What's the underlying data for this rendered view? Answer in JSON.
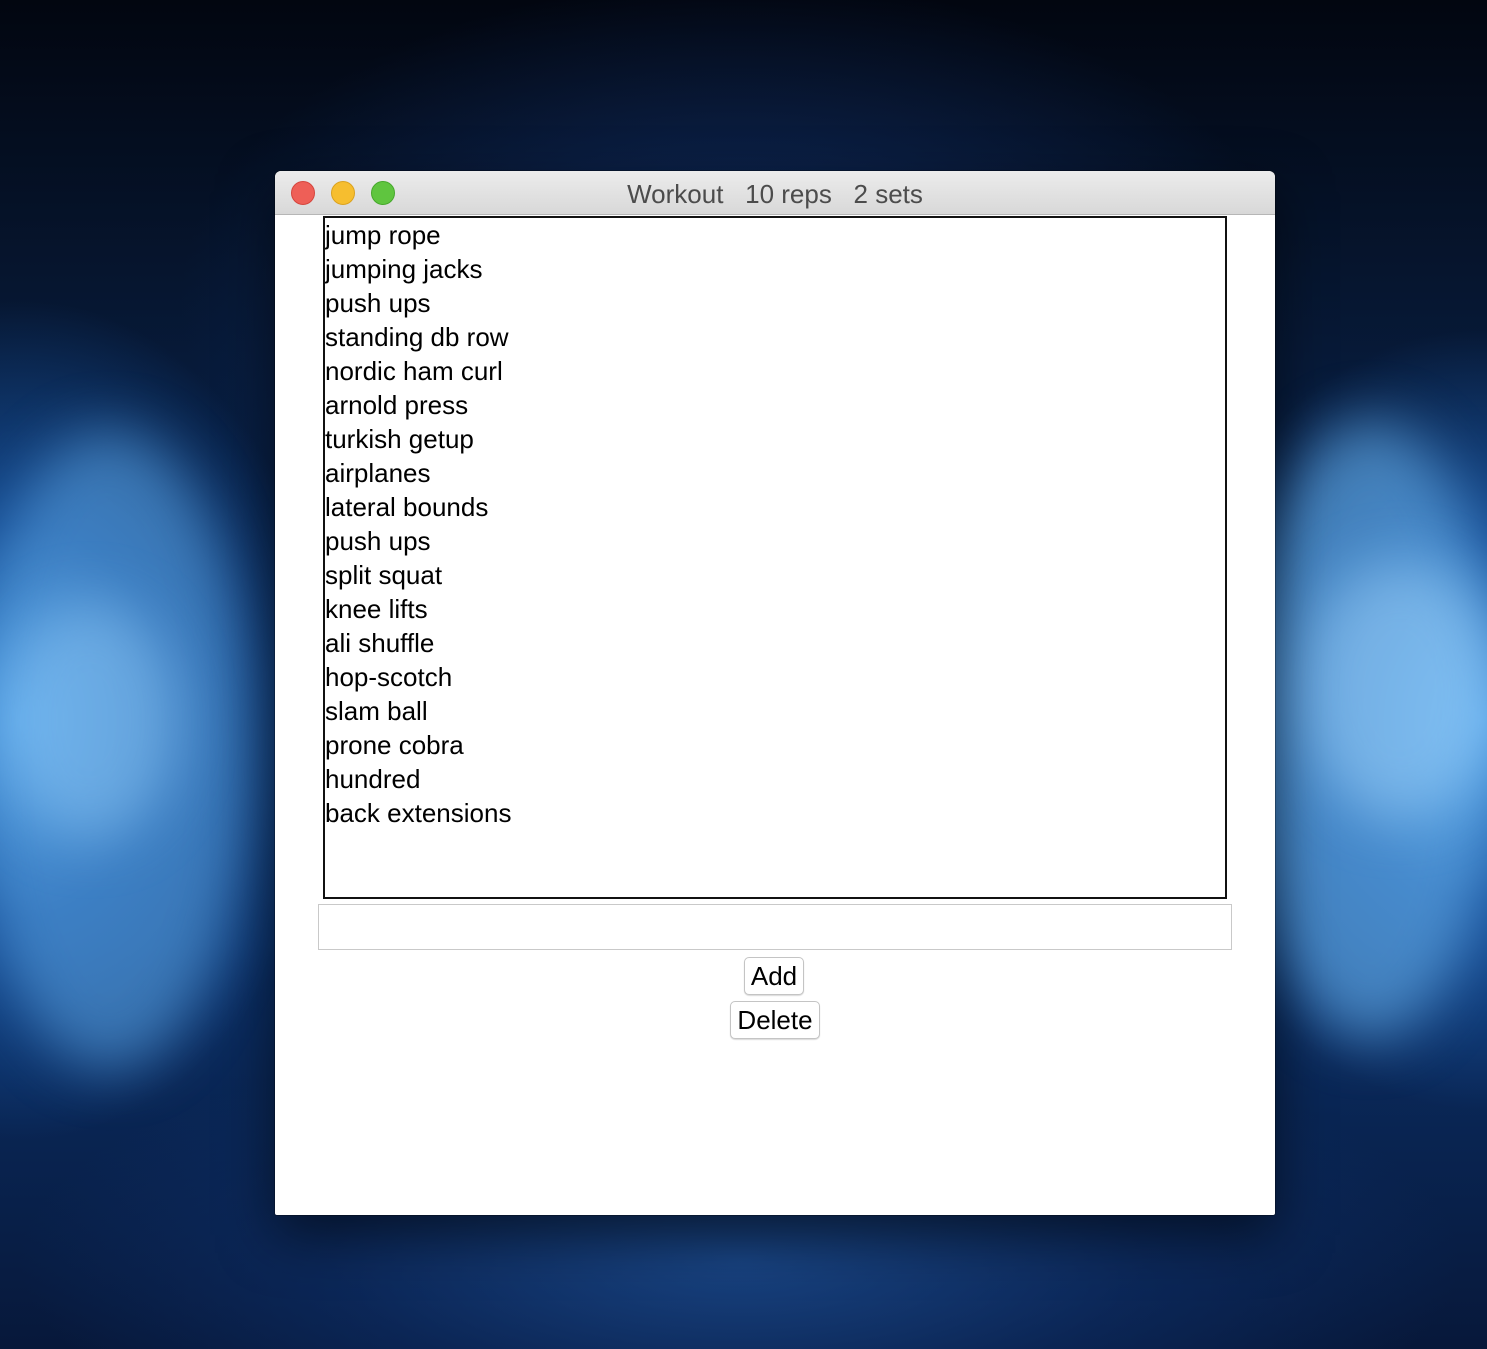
{
  "window": {
    "title": "Workout   10 reps   2 sets"
  },
  "controls": {
    "close": "close",
    "minimize": "minimize",
    "maximize": "maximize"
  },
  "exercises": [
    "jump rope",
    "jumping jacks",
    "push ups",
    "standing db row",
    "nordic ham curl",
    "arnold press",
    "turkish getup",
    "airplanes",
    "lateral bounds",
    "push ups",
    "split squat",
    "knee lifts",
    "ali shuffle",
    "hop-scotch",
    "slam ball",
    "prone cobra",
    "hundred",
    "back extensions"
  ],
  "entry": {
    "value": "",
    "placeholder": ""
  },
  "buttons": {
    "add_label": "Add",
    "delete_label": "Delete"
  },
  "colors": {
    "close": "#ee5f57",
    "minimize": "#f6be2f",
    "maximize": "#5fc53f"
  }
}
